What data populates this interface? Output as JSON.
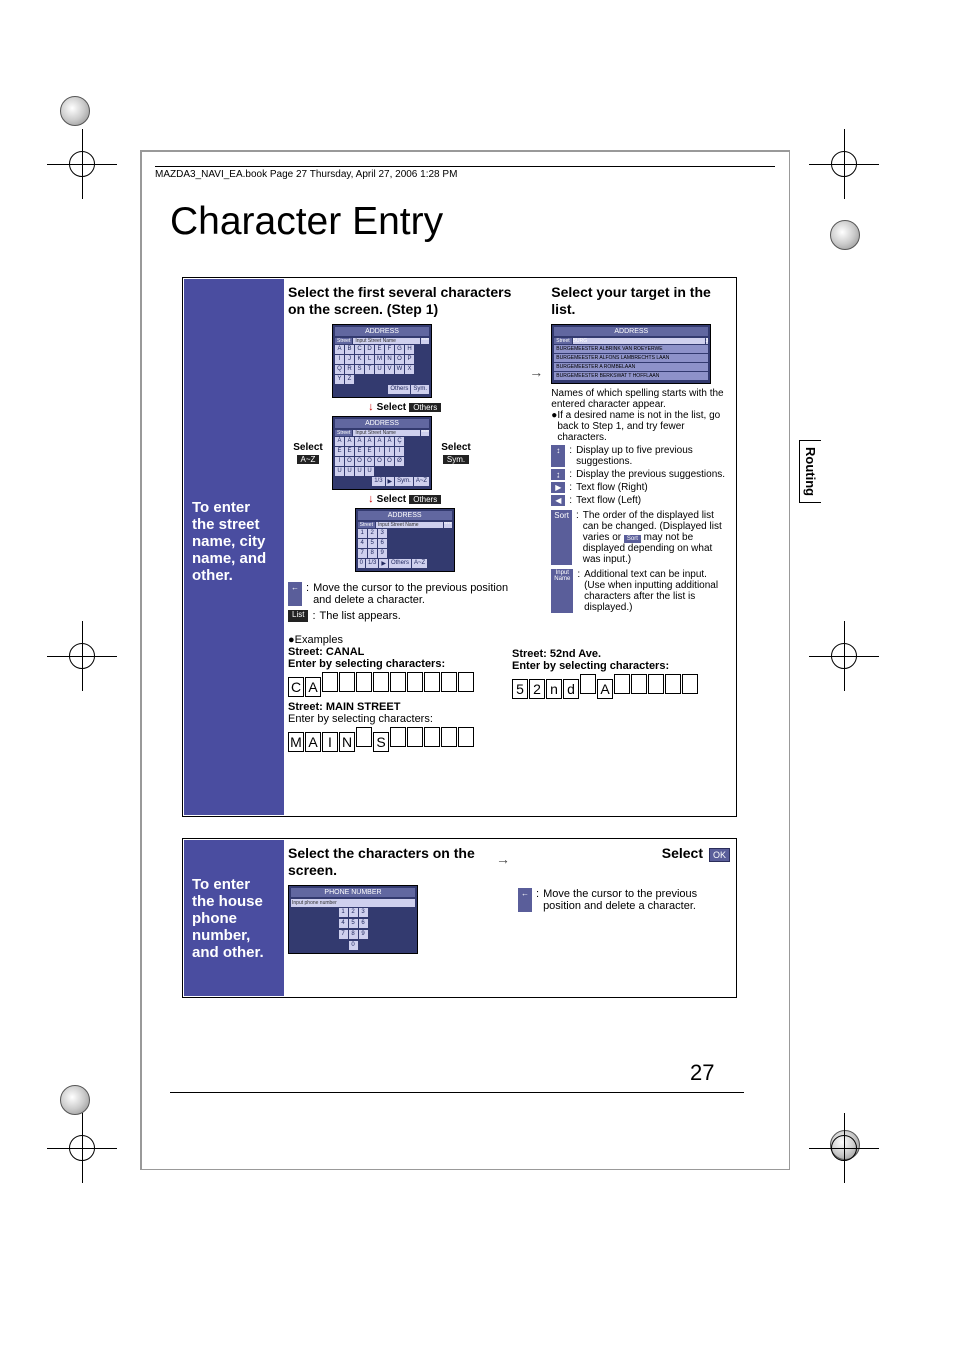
{
  "page_info": "MAZDA3_NAVI_EA.book  Page 27  Thursday, April 27, 2006  1:28 PM",
  "title": "Character Entry",
  "side_tab": "Routing",
  "page_number": "27",
  "section1": {
    "sidebar": "To enter the street name, city name, and other.",
    "col1_heading": "Select the first several characters on the screen. (Step 1)",
    "label_select": "Select",
    "btn_az": "A~Z",
    "btn_sym": "Sym.",
    "btn_others": "Others",
    "btn_list": "List",
    "screen_address": "ADDRESS",
    "street_label": "Street",
    "street_input": "Input Street Name",
    "sel_others": "Select",
    "cursor_text": "Move the cursor to the previous position and delete a character.",
    "list_text": "The list appears.",
    "col2_heading": "Select your target in the list.",
    "list_items": [
      "BURGEMEESTER ALBRINK VAN ROEYERWE",
      "BURGEMEESTER ALFONS LAMBRECHTS LAAN",
      "BURGEMEESTER A ROMBELAAN",
      "BURGEMEESTER BERKSWAT T HOFFLAAN"
    ],
    "note1": "Names of which spelling starts with the entered character appear.",
    "note2": "If a desired name is not in the list, go back to Step 1, and try fewer characters.",
    "icon_desc": [
      {
        "icon": "↕",
        "text": "Display up to five previous suggestions."
      },
      {
        "icon": "↨",
        "text": "Display the previous suggestions."
      },
      {
        "icon": "▶",
        "text": "Text flow (Right)"
      },
      {
        "icon": "◀",
        "text": "Text flow (Left)"
      }
    ],
    "sort_label": "Sort",
    "sort_text": "The order of the displayed list can be changed. (Displayed list varies or ",
    "sort_text2": " may not be displayed depending on what was input.)",
    "input_name_label": "Input Name",
    "input_name_text": "Additional text can be input. (Use when inputting additional characters after the list is displayed.)",
    "examples_label": "Examples",
    "ex1_label": "Street: CANAL",
    "ex1_instr": "Enter by selecting characters:",
    "ex1_chars": [
      "C",
      "A",
      "",
      "",
      "",
      "",
      "",
      "",
      "",
      "",
      ""
    ],
    "ex2_label": "Street: MAIN STREET",
    "ex2_instr": "Enter by selecting characters:",
    "ex2_chars": [
      "M",
      "A",
      "I",
      "N",
      "",
      "S",
      "",
      "",
      "",
      "",
      ""
    ],
    "ex3_label": "Street: 52nd Ave.",
    "ex3_instr": "Enter by selecting characters:",
    "ex3_chars": [
      "5",
      "2",
      "n",
      "d",
      "",
      "A",
      "",
      "",
      "",
      "",
      ""
    ]
  },
  "section2": {
    "sidebar": "To enter the house phone number, and other.",
    "heading1": "Select the characters on the screen.",
    "heading2": "Select",
    "ok_label": "OK",
    "screen_title": "PHONE NUMBER",
    "screen_input": "Input phone number",
    "cursor_text": "Move the cursor to the previous position and delete a character."
  },
  "keyboard_letters": [
    "A",
    "B",
    "C",
    "D",
    "E",
    "F",
    "G",
    "H",
    "I",
    "J",
    "K",
    "L",
    "M",
    "N",
    "O",
    "P",
    "Q",
    "R",
    "S",
    "T",
    "U",
    "V",
    "W",
    "X",
    "Y",
    "Z"
  ],
  "keyboard_accents": [
    "Á",
    "À",
    "Â",
    "Ä",
    "Ã",
    "Å",
    "Ç",
    "È",
    "É",
    "Ê",
    "Ë",
    "Í",
    "Î",
    "Ï",
    "Ì",
    "Ó",
    "Ô",
    "Ö",
    "Ò",
    "Õ",
    "Ø",
    "Ú",
    "Ù",
    "Û",
    "Ü"
  ],
  "keyboard_nums": [
    "1",
    "2",
    "3",
    "4",
    "5",
    "6",
    "7",
    "8",
    "9",
    "0"
  ]
}
